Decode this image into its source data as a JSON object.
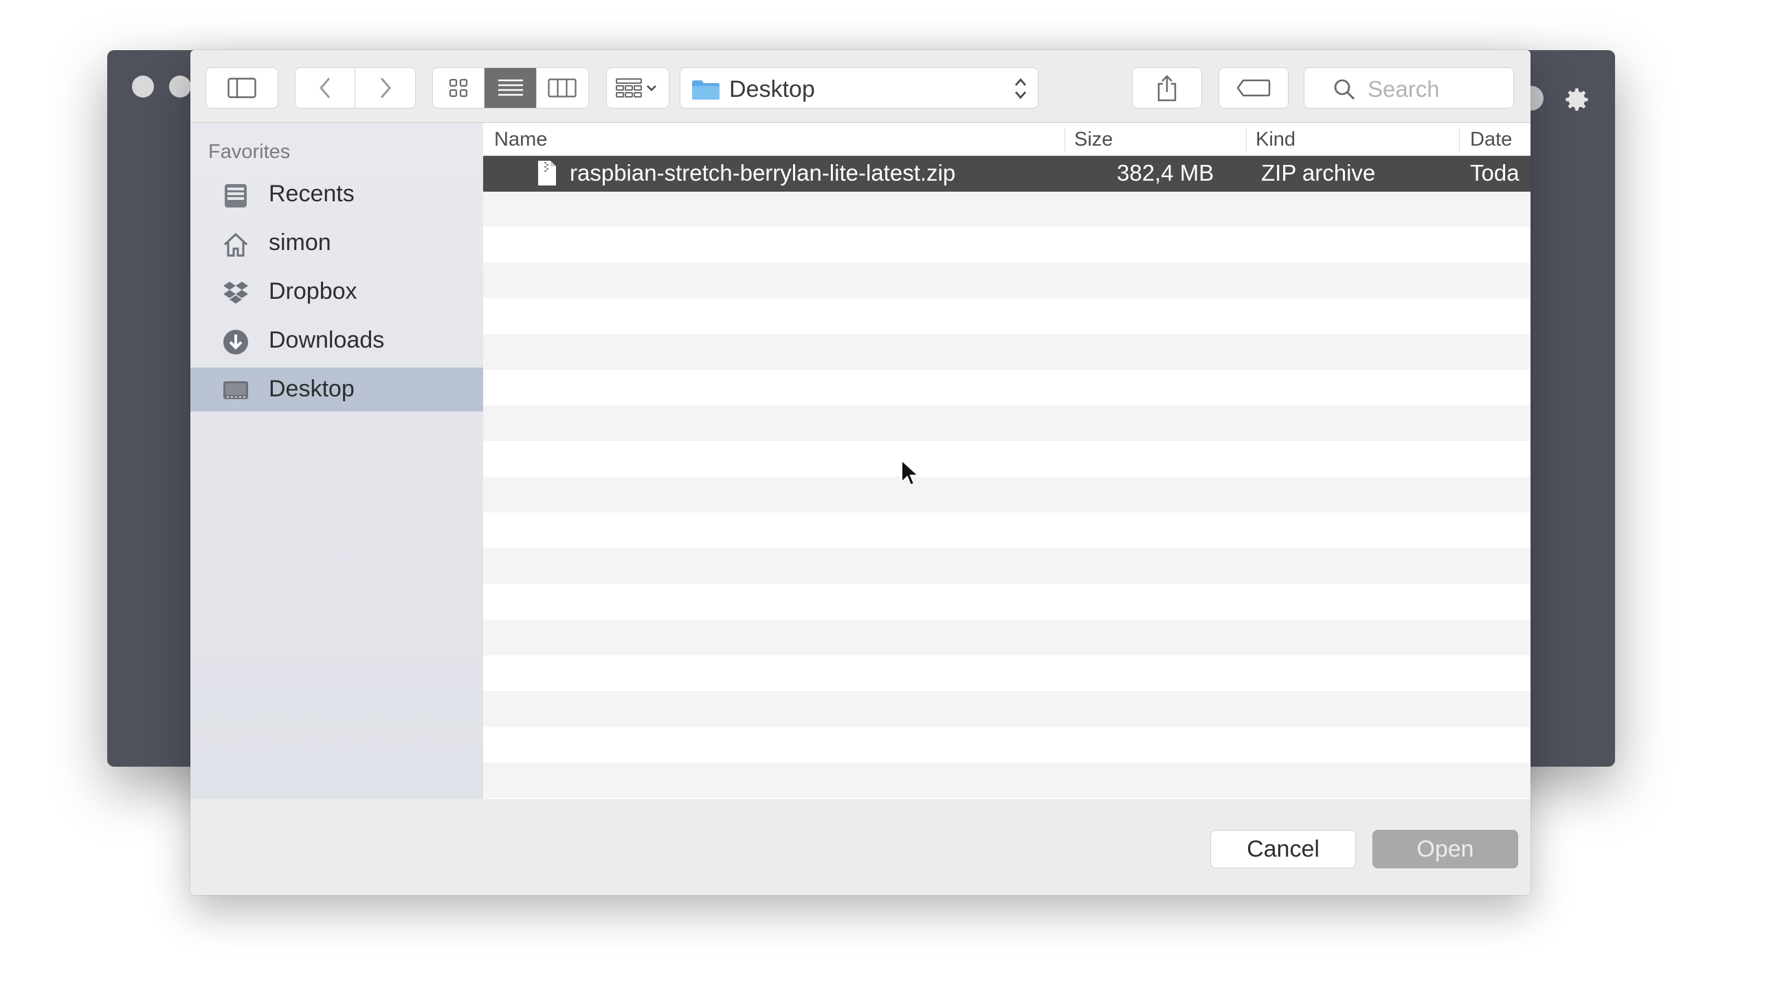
{
  "toolbar": {
    "location": "Desktop",
    "search_placeholder": "Search"
  },
  "sidebar": {
    "header": "Favorites",
    "items": [
      {
        "label": "Recents",
        "icon": "recents-icon"
      },
      {
        "label": "simon",
        "icon": "home-icon"
      },
      {
        "label": "Dropbox",
        "icon": "dropbox-icon"
      },
      {
        "label": "Downloads",
        "icon": "downloads-icon"
      },
      {
        "label": "Desktop",
        "icon": "desktop-icon",
        "selected": true
      }
    ]
  },
  "columns": {
    "name": "Name",
    "size": "Size",
    "kind": "Kind",
    "date": "Date"
  },
  "files": [
    {
      "name": "raspbian-stretch-berrylan-lite-latest.zip",
      "size": "382,4 MB",
      "kind": "ZIP archive",
      "date": "Toda",
      "selected": true
    }
  ],
  "buttons": {
    "cancel": "Cancel",
    "open": "Open"
  },
  "colors": {
    "selection_row": "#4b4b4b",
    "sidebar_selection": "#b9c3d3",
    "folder_blue": "#5aa9e6",
    "background_window": "#4f525b"
  }
}
